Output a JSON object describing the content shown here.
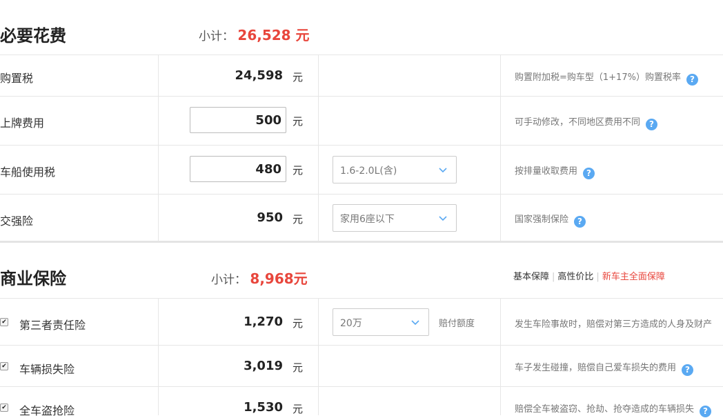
{
  "required": {
    "title": "必要花费",
    "subtotal_label": "小计：",
    "subtotal_value": "26,528 元",
    "unit": "元",
    "rows": [
      {
        "label": "购置税",
        "amount": "24,598",
        "note": "购置附加税=购车型（1+17%）购置税率"
      },
      {
        "label": "上牌费用",
        "amount": "500",
        "note": "可手动修改，不同地区费用不同"
      },
      {
        "label": "车船使用税",
        "amount": "480",
        "select": "1.6-2.0L(含)",
        "note": "按排量收取费用"
      },
      {
        "label": "交强险",
        "amount": "950",
        "select": "家用6座以下",
        "note": "国家强制保险"
      }
    ]
  },
  "commercial": {
    "title": "商业保险",
    "subtotal_label": "小计：",
    "subtotal_value": "8,968元",
    "plans": [
      "基本保障",
      "高性价比",
      "新车主全面保障"
    ],
    "unit": "元",
    "rows": [
      {
        "label": "第三者责任险",
        "amount": "1,270",
        "select": "20万",
        "extra": "赔付额度",
        "note": "发生车险事故时，赔偿对第三方造成的人身及财产"
      },
      {
        "label": "车辆损失险",
        "amount": "3,019",
        "note": "车子发生碰撞，赔偿自己爱车损失的费用"
      },
      {
        "label": "全车盗抢险",
        "amount": "1,530",
        "note": "赔偿全车被盗窃、抢劫、抢夺造成的车辆损失"
      }
    ]
  },
  "icons": {
    "help": "help-icon",
    "chevron": "chevron-down-icon",
    "check": "checkbox-checked-icon"
  },
  "colors": {
    "accent": "#e8463c",
    "help": "#5aa9f2"
  }
}
